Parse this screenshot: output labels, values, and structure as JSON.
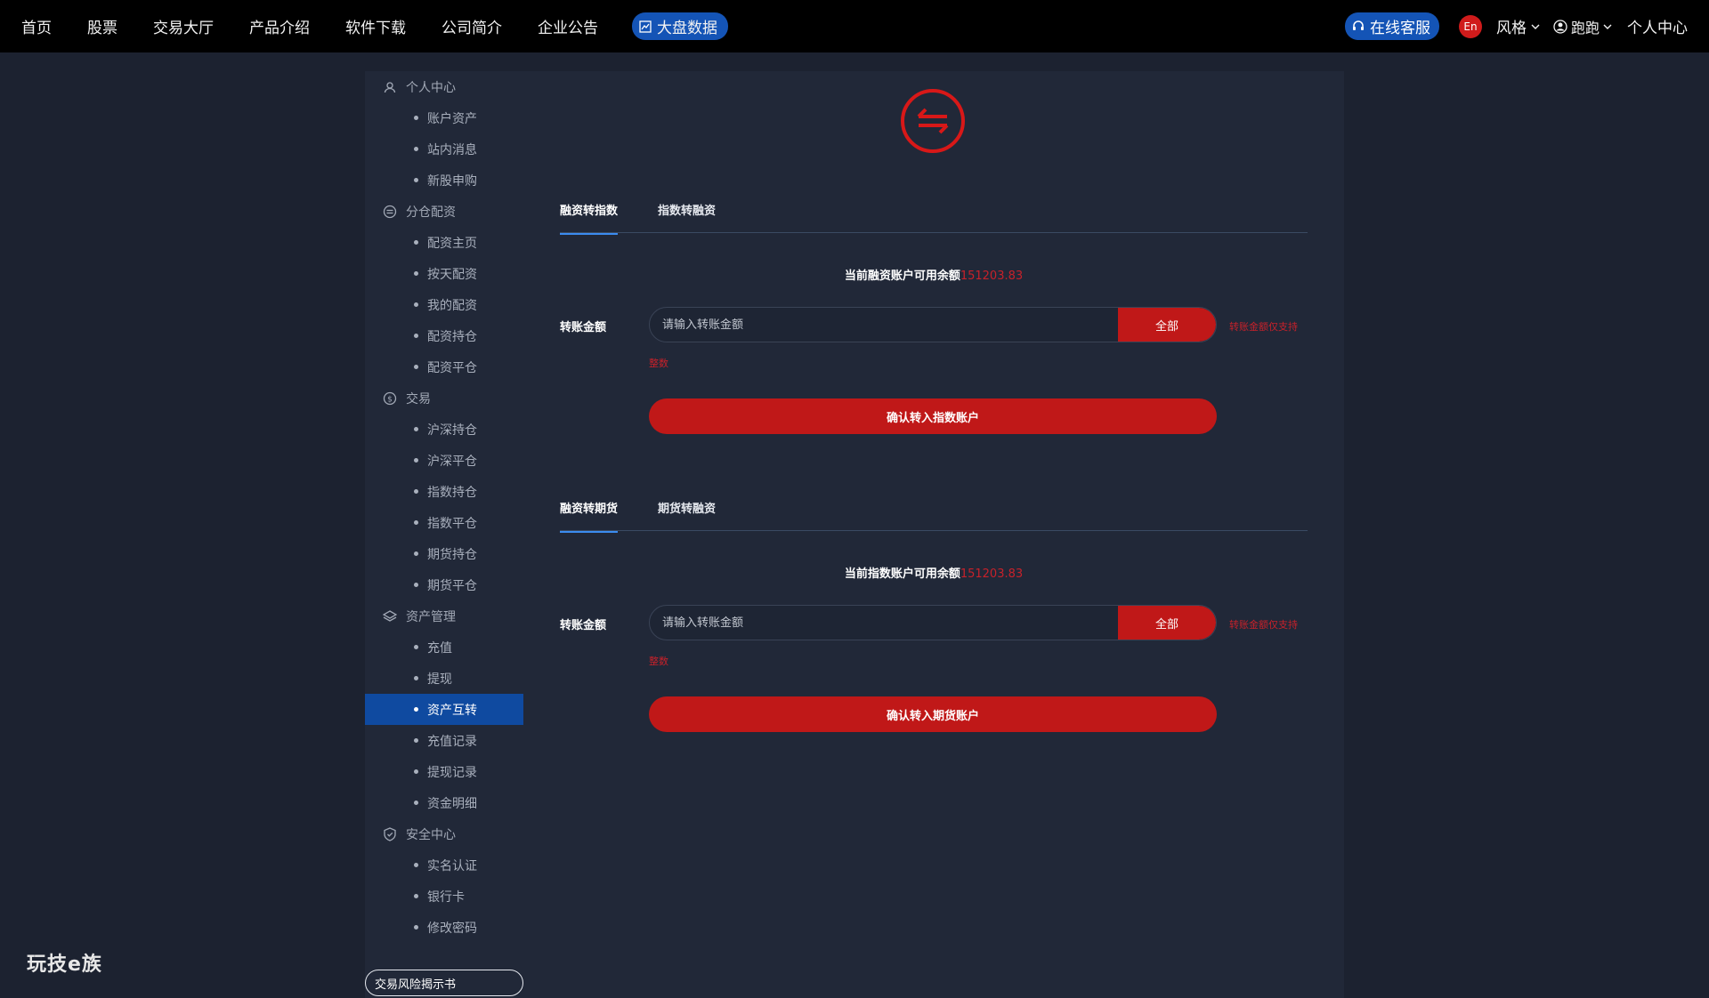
{
  "nav": {
    "items": [
      "首页",
      "股票",
      "交易大厅",
      "产品介绍",
      "软件下载",
      "公司简介",
      "企业公告"
    ],
    "highlight": "大盘数据"
  },
  "header_right": {
    "service": "在线客服",
    "lang": "En",
    "style": "风格",
    "user": "跑跑",
    "personal": "个人中心"
  },
  "sidebar": {
    "groups": [
      {
        "label": "个人中心",
        "icon": "user-icon",
        "items": [
          "账户资产",
          "站内消息",
          "新股申购"
        ]
      },
      {
        "label": "分仓配资",
        "icon": "exchange-icon",
        "items": [
          "配资主页",
          "按天配资",
          "我的配资",
          "配资持仓",
          "配资平仓"
        ]
      },
      {
        "label": "交易",
        "icon": "coin-icon",
        "items": [
          "沪深持仓",
          "沪深平仓",
          "指数持仓",
          "指数平仓",
          "期货持仓",
          "期货平仓"
        ]
      },
      {
        "label": "资产管理",
        "icon": "layers-icon",
        "items": [
          "充值",
          "提现",
          "资产互转",
          "充值记录",
          "提现记录",
          "资金明细"
        ]
      },
      {
        "label": "安全中心",
        "icon": "shield-icon",
        "items": [
          "实名认证",
          "银行卡",
          "修改密码"
        ]
      }
    ],
    "active_item": "资产互转",
    "risk_button": "交易风险揭示书"
  },
  "section1": {
    "tabs": [
      "融资转指数",
      "指数转融资"
    ],
    "balance_label": "当前融资账户可用余额",
    "balance_value": "151203.83",
    "amount_label": "转账金额",
    "placeholder": "请输入转账金额",
    "all_button": "全部",
    "hint_main": "转账金额仅支持",
    "hint_sub": "整数",
    "confirm": "确认转入指数账户"
  },
  "section2": {
    "tabs": [
      "融资转期货",
      "期货转融资"
    ],
    "balance_label": "当前指数账户可用余额",
    "balance_value": "151203.83",
    "amount_label": "转账金额",
    "placeholder": "请输入转账金额",
    "all_button": "全部",
    "hint_main": "转账金额仅支持",
    "hint_sub": "整数",
    "confirm": "确认转入期货账户"
  },
  "watermark": "玩技e族",
  "colors": {
    "accent_red": "#c01818",
    "accent_blue": "#1454b6",
    "panel": "#212838",
    "bg": "#1c2230"
  }
}
